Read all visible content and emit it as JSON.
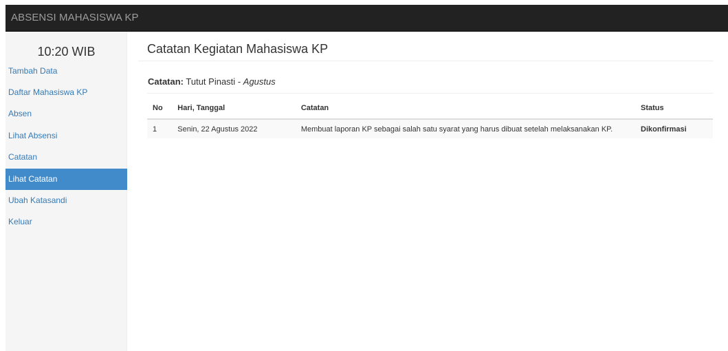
{
  "navbar": {
    "brand": "ABSENSI MAHASISWA KP"
  },
  "sidebar": {
    "clock": "10:20 WIB",
    "items": [
      {
        "label": "Tambah Data"
      },
      {
        "label": "Daftar Mahasiswa KP"
      },
      {
        "label": "Absen"
      },
      {
        "label": "Lihat Absensi"
      },
      {
        "label": "Catatan"
      },
      {
        "label": "Lihat Catatan",
        "active": true
      },
      {
        "label": "Ubah Katasandi"
      },
      {
        "label": "Keluar"
      }
    ]
  },
  "main": {
    "title": "Catatan Kegiatan Mahasiswa KP",
    "subhead": {
      "prefix": "Catatan:",
      "name": "Tutut Pinasti",
      "separator": "-",
      "month": "Agustus"
    },
    "table": {
      "headers": [
        "No",
        "Hari, Tanggal",
        "Catatan",
        "Status"
      ],
      "rows": [
        [
          "1",
          "Senin, 22 Agustus 2022",
          "Membuat laporan KP sebagai salah satu syarat yang harus dibuat setelah melaksanakan KP.",
          "Dikonfirmasi"
        ]
      ]
    }
  },
  "colors": {
    "navbar_bg": "#222222",
    "brand_text": "#9d9d9d",
    "sidebar_bg": "#f5f5f5",
    "link": "#337ab7",
    "active_bg": "#428bca",
    "active_text": "#ffffff"
  }
}
